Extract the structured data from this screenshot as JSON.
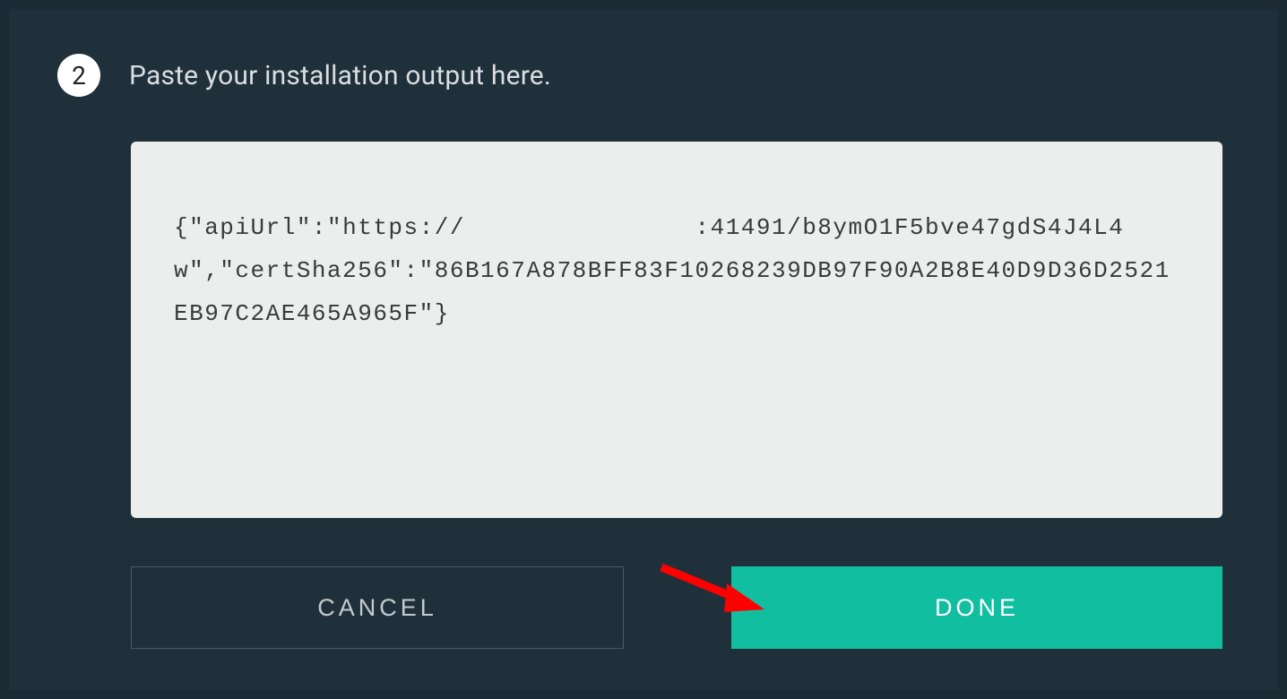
{
  "step": {
    "number": "2",
    "title": "Paste your installation output here."
  },
  "textarea": {
    "value": "{\"apiUrl\":\"https://               :41491/b8ymO1F5bve47gdS4J4L4w\",\"certSha256\":\"86B167A878BFF83F10268239DB97F90A2B8E40D9D36D2521EB97C2AE465A965F\"}"
  },
  "buttons": {
    "cancel": "CANCEL",
    "done": "DONE"
  }
}
